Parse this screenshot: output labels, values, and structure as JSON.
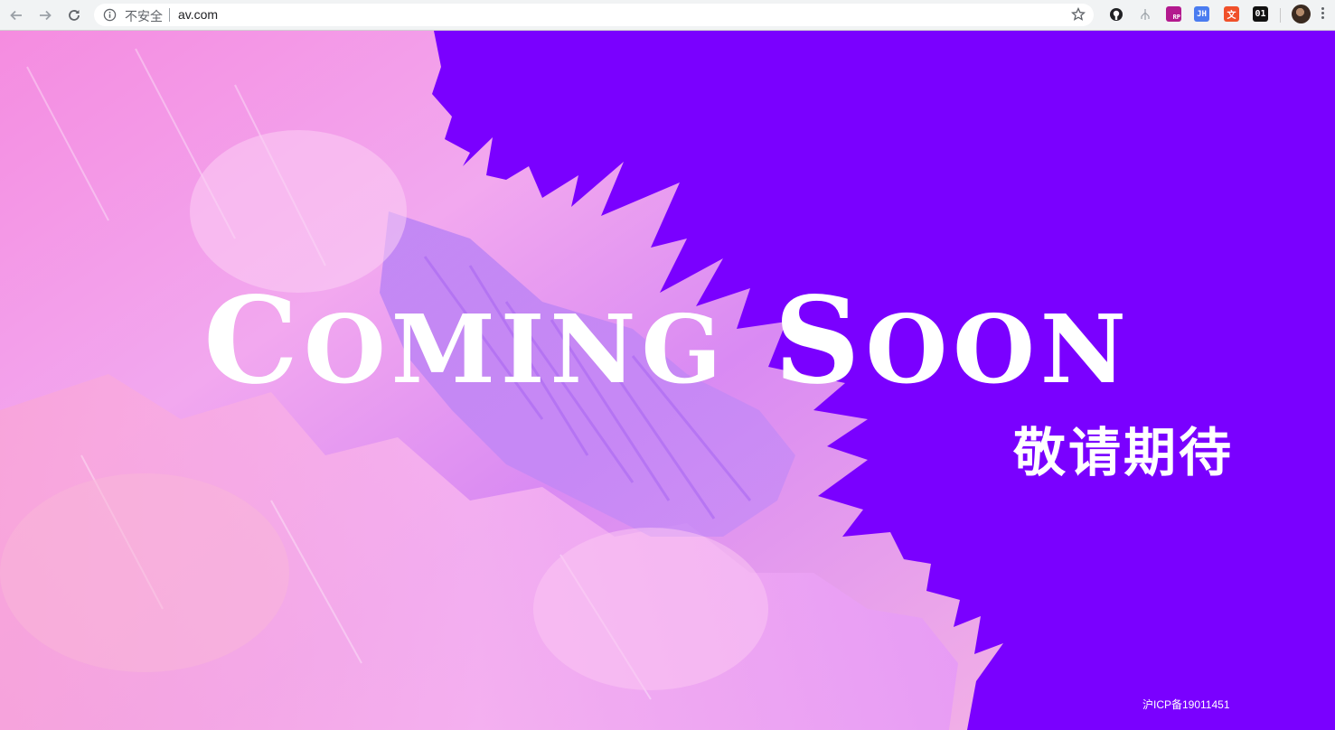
{
  "browser": {
    "security_label": "不安全",
    "url": "av.com",
    "extensions": [
      {
        "name": "github-extension-icon",
        "text": "",
        "color": "#202124"
      },
      {
        "name": "tree-extension-icon",
        "text": "",
        "color": "#9aa0a6"
      },
      {
        "name": "rp-extension-icon",
        "text": "RP",
        "color": "#b3198e"
      },
      {
        "name": "jh-extension-icon",
        "text": "JH",
        "color": "#4a7cf0"
      },
      {
        "name": "translate-extension-icon",
        "text": "文",
        "color": "#f0502a"
      },
      {
        "name": "binary-extension-icon",
        "text": "01",
        "color": "#111111"
      }
    ]
  },
  "page": {
    "headline_first": "C",
    "headline_rest1": "OMING",
    "headline_second": "S",
    "headline_rest2": "OON",
    "subtitle": "敬请期待",
    "icp": "沪ICP备19011451",
    "colors": {
      "background": "#7a00ff",
      "text": "#ffffff"
    }
  }
}
